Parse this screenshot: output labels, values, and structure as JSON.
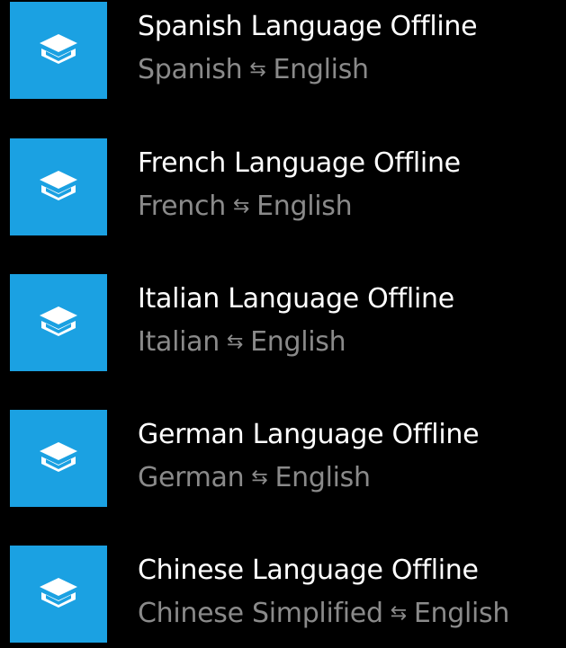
{
  "theme": {
    "background": "#000000",
    "tile_color": "#1ba1e2",
    "title_color": "#ffffff",
    "subtitle_color": "#8a8a8a"
  },
  "icons": {
    "tile_icon": "book-stack-icon",
    "swap_icon": "swap-arrows-icon"
  },
  "items": [
    {
      "title": "Spanish Language Offline",
      "from": "Spanish",
      "arrow": "⇆",
      "to": "English"
    },
    {
      "title": "French Language Offline",
      "from": "French",
      "arrow": "⇆",
      "to": "English"
    },
    {
      "title": "Italian Language Offline",
      "from": "Italian",
      "arrow": "⇆",
      "to": "English"
    },
    {
      "title": "German Language Offline",
      "from": "German",
      "arrow": "⇆",
      "to": "English"
    },
    {
      "title": "Chinese Language Offline",
      "from": "Chinese Simplified",
      "arrow": "⇆",
      "to": "English"
    }
  ]
}
